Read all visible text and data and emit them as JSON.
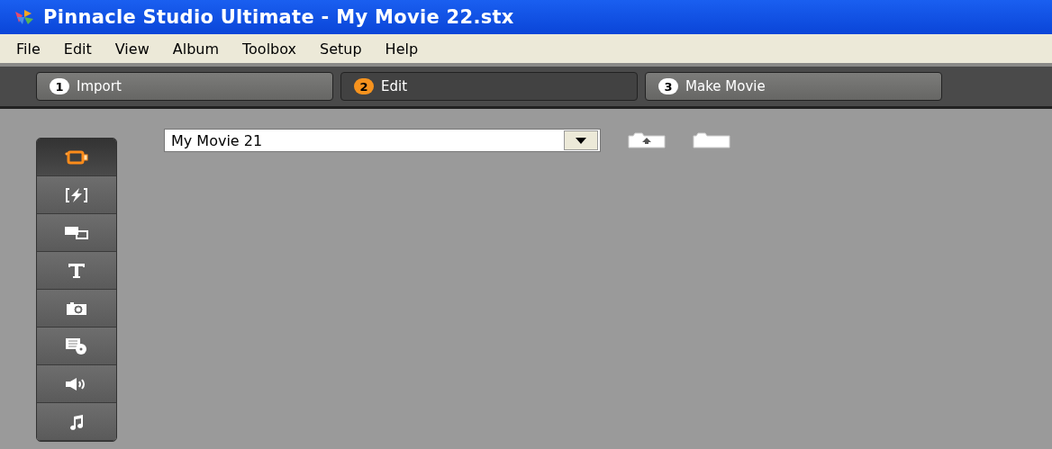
{
  "window": {
    "title": "Pinnacle Studio Ultimate - My Movie 22.stx"
  },
  "menu": [
    "File",
    "Edit",
    "View",
    "Album",
    "Toolbox",
    "Setup",
    "Help"
  ],
  "steps": [
    {
      "number": "1",
      "label": "Import",
      "selected": false
    },
    {
      "number": "2",
      "label": "Edit",
      "selected": true
    },
    {
      "number": "3",
      "label": "Make Movie",
      "selected": false
    }
  ],
  "album_tabs": [
    {
      "kind": "video",
      "selected": true
    },
    {
      "kind": "transitions",
      "selected": false
    },
    {
      "kind": "overlays",
      "selected": false
    },
    {
      "kind": "titles",
      "selected": false
    },
    {
      "kind": "photos",
      "selected": false
    },
    {
      "kind": "disc-menus",
      "selected": false
    },
    {
      "kind": "sound-effects",
      "selected": false
    },
    {
      "kind": "music",
      "selected": false
    }
  ],
  "album_select": {
    "value": "My Movie 21"
  }
}
